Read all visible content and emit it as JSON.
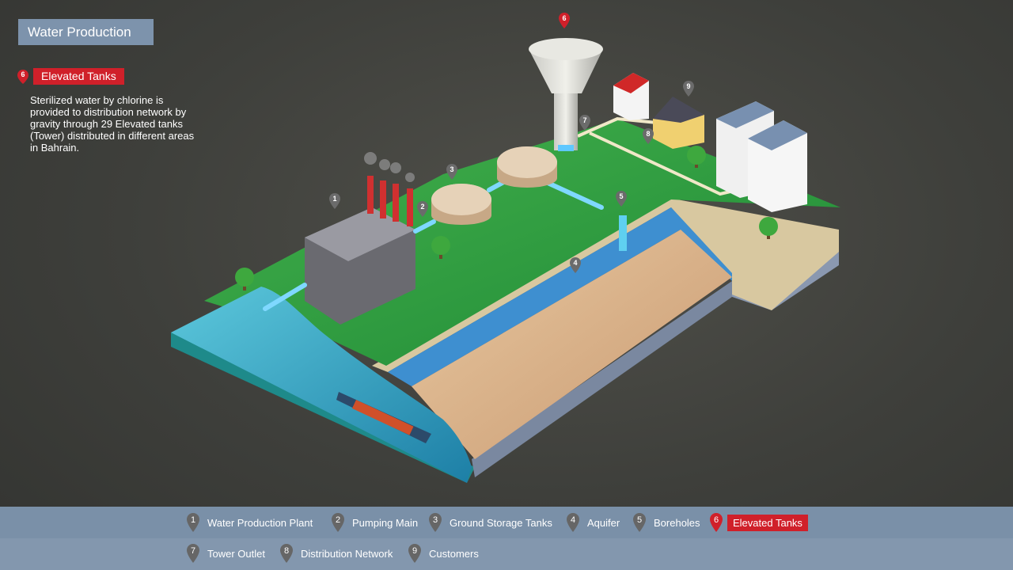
{
  "header": {
    "title": "Water Production"
  },
  "info": {
    "number": "6",
    "label": "Elevated Tanks",
    "description": "Sterilized water by chlorine is provided to distribution network by gravity through 29 Elevated tanks (Tower) distributed in different areas in Bahrain."
  },
  "map_pins": [
    {
      "num": "1"
    },
    {
      "num": "2"
    },
    {
      "num": "3"
    },
    {
      "num": "4"
    },
    {
      "num": "5"
    },
    {
      "num": "6"
    },
    {
      "num": "7"
    },
    {
      "num": "8"
    },
    {
      "num": "9"
    }
  ],
  "legend": [
    {
      "num": "1",
      "label": "Water Production Plant"
    },
    {
      "num": "2",
      "label": "Pumping Main"
    },
    {
      "num": "3",
      "label": "Ground Storage Tanks"
    },
    {
      "num": "4",
      "label": "Aquifer"
    },
    {
      "num": "5",
      "label": "Boreholes"
    },
    {
      "num": "6",
      "label": "Elevated Tanks",
      "active": true
    },
    {
      "num": "7",
      "label": "Tower Outlet"
    },
    {
      "num": "8",
      "label": "Distribution Network"
    },
    {
      "num": "9",
      "label": "Customers"
    }
  ],
  "colors": {
    "accent_red": "#d0202a",
    "bar_blue": "#7d93ac",
    "pin_gray": "#666666",
    "grass": "#2f9a3e",
    "sea": "#2aa0b8"
  }
}
